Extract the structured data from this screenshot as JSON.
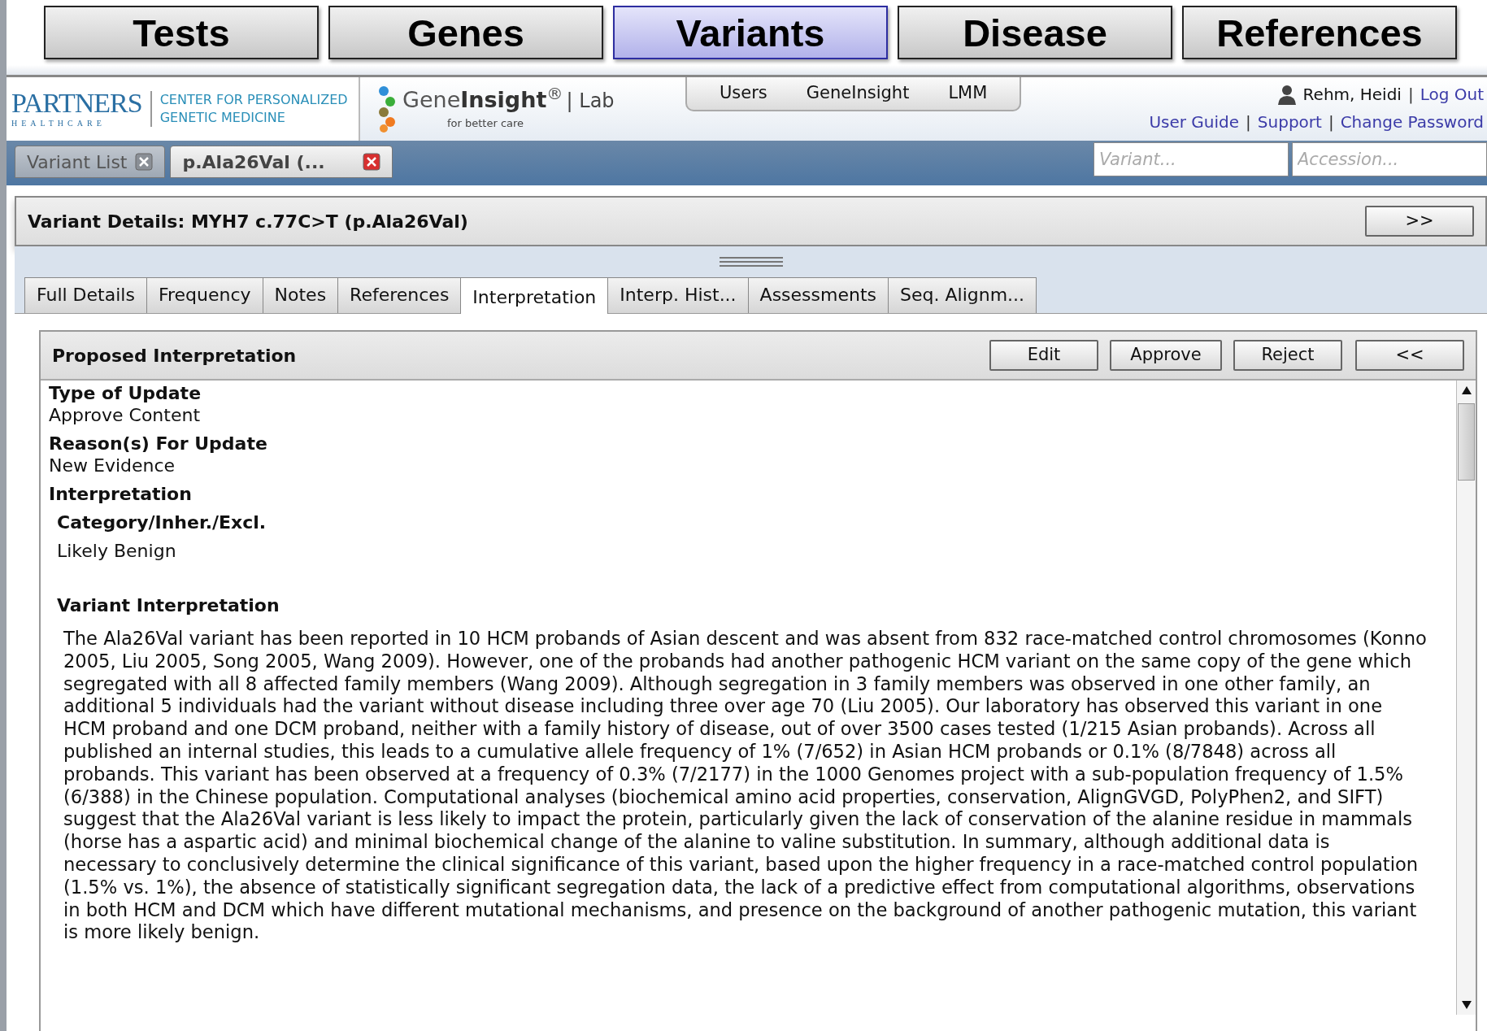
{
  "top_nav": [
    {
      "label": "Tests",
      "selected": false
    },
    {
      "label": "Genes",
      "selected": false
    },
    {
      "label": "Variants",
      "selected": true
    },
    {
      "label": "Disease",
      "selected": false
    },
    {
      "label": "References",
      "selected": false
    }
  ],
  "header": {
    "partners": "PARTNERS",
    "partners_sub": "HEALTHCARE",
    "center": "CENTER FOR PERSONALIZED",
    "center_sub": "GENETIC MEDICINE",
    "brand": "Gene**Insight**$^{®}$",
    "brand_suffix": "| Lab",
    "tagline": "for better care"
  },
  "app_menu": [
    "Users",
    "GeneInsight",
    "LMM"
  ],
  "user": {
    "name": "Rehm, Heidi",
    "separator": "|",
    "logout": "Log Out"
  },
  "links": [
    {
      "kind": "link",
      "label": "User Guide"
    },
    {
      "kind": "separator",
      "label": "|"
    },
    {
      "kind": "link",
      "label": "Support"
    },
    {
      "kind": "separator",
      "label": "|"
    },
    {
      "kind": "link",
      "label": "Change Password"
    }
  ],
  "doc_tabs": [
    {
      "label": "Variant List",
      "selected": false
    },
    {
      "label": "p.Ala26Val (...",
      "selected": true
    }
  ],
  "search_fields": [
    {
      "placeholder": "Variant..."
    },
    {
      "placeholder": "Accession..."
    }
  ],
  "variant_panel": {
    "title": "Variant Details: MYH7 c.77C>T (p.Ala26Val)",
    "button": ">>"
  },
  "detail_tabs": [
    {
      "label": "Full Details",
      "selected": false
    },
    {
      "label": "Frequency",
      "selected": false
    },
    {
      "label": "Notes",
      "selected": false
    },
    {
      "label": "References",
      "selected": false
    },
    {
      "label": "Interpretation",
      "selected": true
    },
    {
      "label": "Interp. Hist...",
      "selected": false
    },
    {
      "label": "Assessments",
      "selected": false
    },
    {
      "label": "Seq. Alignm...",
      "selected": false
    }
  ],
  "interpretation_panel": {
    "title": "Proposed Interpretation",
    "buttons": [
      "Edit",
      "Approve",
      "Reject",
      "<<"
    ],
    "sections": [
      {
        "kind": "field",
        "label": "Type of Update",
        "value": "Approve Content"
      },
      {
        "kind": "field",
        "label": "Reason(s) For Update",
        "value": "New Evidence"
      },
      {
        "kind": "heading",
        "label": "Interpretation"
      },
      {
        "kind": "subfield",
        "label": "Category/Inher./Excl.",
        "value": "Likely Benign"
      },
      {
        "kind": "paragraph",
        "label": "Variant Interpretation",
        "value": "The Ala26Val variant has been reported in 10 HCM probands of Asian descent and was absent from 832 race-matched control chromosomes (Konno 2005, Liu 2005, Song 2005, Wang 2009). However, one of the probands had another pathogenic HCM variant on the same copy of the gene which segregated with all 8 affected family members (Wang 2009). Although segregation in 3 family members was observed in one other family, an additional 5 individuals had the variant without disease including three over age 70 (Liu 2005). Our laboratory has observed this variant in one HCM proband and one DCM proband, neither with a family history of disease, out of over 3500 cases tested (1/215 Asian probands). Across all published an internal studies, this leads to a cumulative allele frequency of 1% (7/652) in Asian HCM probands or 0.1% (8/7848) across all probands. This variant has been observed at a frequency of 0.3% (7/2177) in the 1000 Genomes project with a sub-population frequency of 1.5% (6/388) in the Chinese population. Computational analyses (biochemical amino acid properties, conservation, AlignGVGD, PolyPhen2, and SIFT) suggest that the Ala26Val variant is less likely to impact the protein, particularly given the lack of conservation of the alanine residue in mammals (horse has a aspartic acid) and minimal biochemical change of the alanine to valine substitution. In summary, although additional data is necessary to conclusively determine the clinical significance of this variant, based upon the higher frequency in a race-matched control population (1.5% vs. 1%), the absence of statistically significant segregation data, the lack of a predictive effect from computational algorithms, observations in both HCM and DCM which have different mutational mechanisms, and presence on the background of another pathogenic mutation, this variant is more likely benign."
      }
    ]
  }
}
